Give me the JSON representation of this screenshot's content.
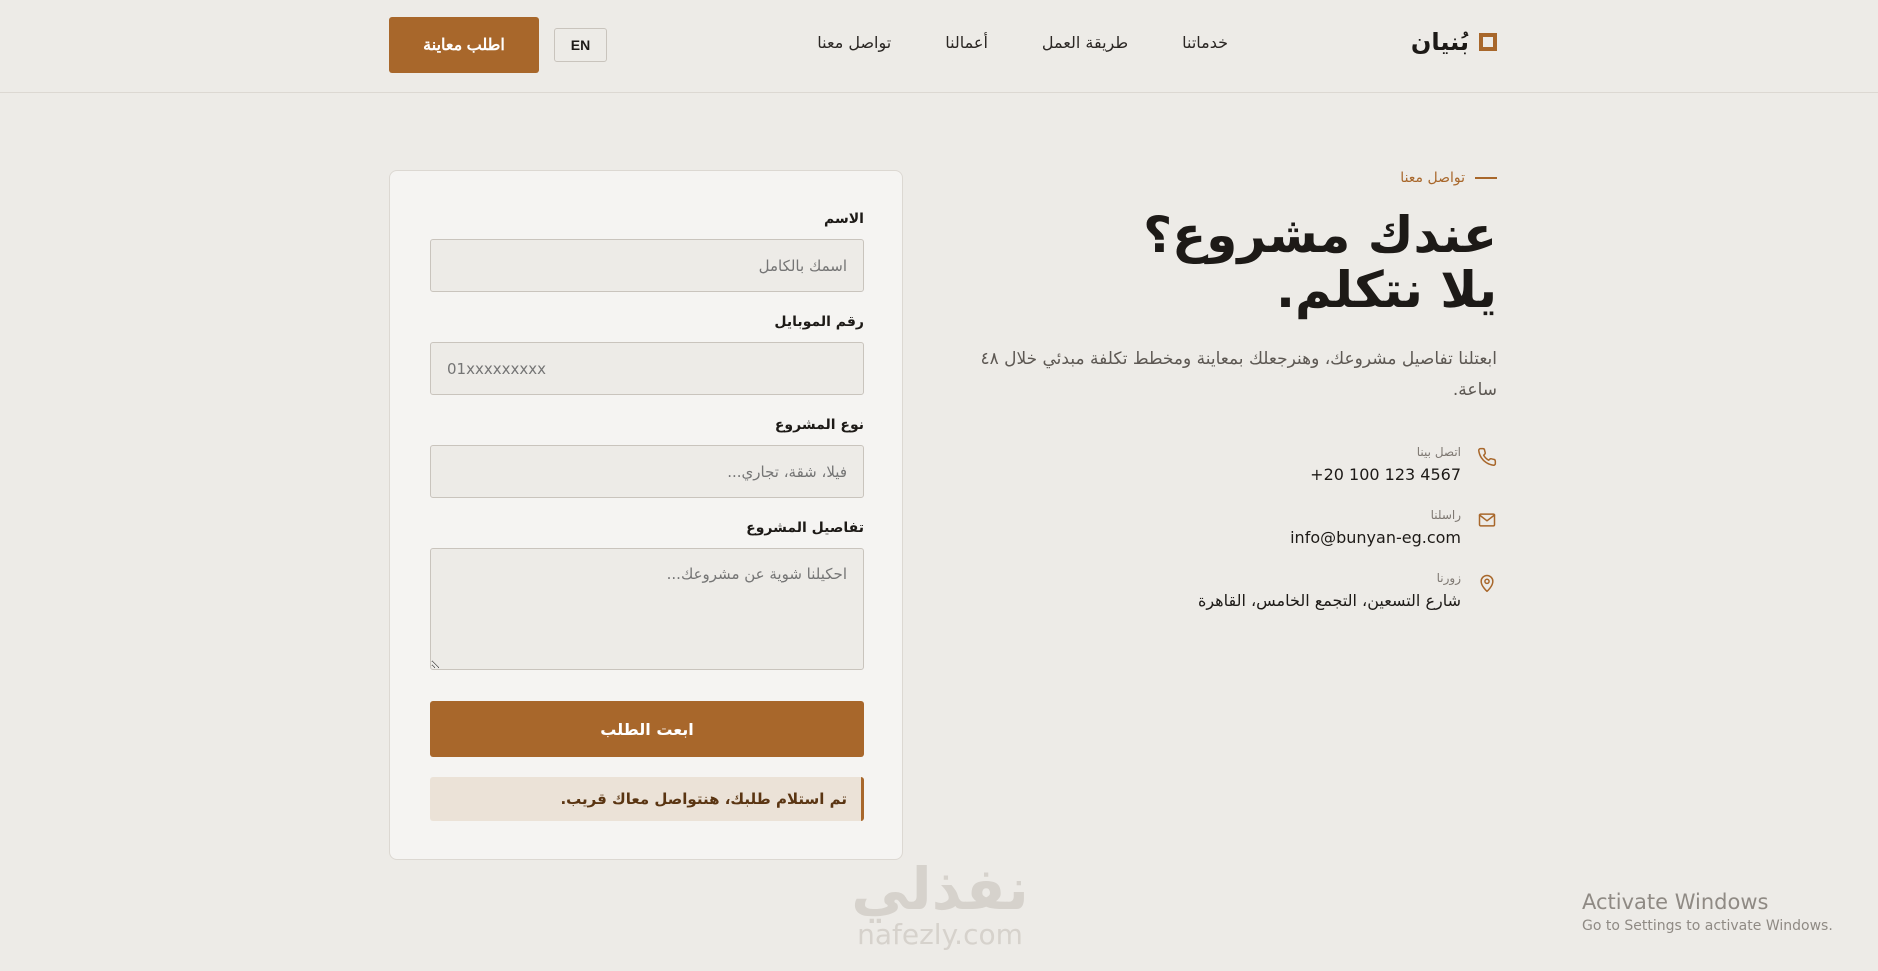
{
  "header": {
    "brand": "بُنيان",
    "nav": [
      "خدماتنا",
      "طريقة العمل",
      "أعمالنا",
      "تواصل معنا"
    ],
    "lang_label": "EN",
    "cta_label": "اطلب معاينة"
  },
  "info": {
    "eyebrow": "تواصل معنا",
    "headline_line1": "عندك مشروع؟",
    "headline_line2": "يلا نتكلم.",
    "lead": "ابعتلنا تفاصيل مشروعك، وهنرجعلك بمعاينة ومخطط تكلفة مبدئي خلال ٤٨ ساعة.",
    "contacts": [
      {
        "key": "اتصل بينا",
        "value": "+20 100 123 4567",
        "icon": "phone-icon"
      },
      {
        "key": "راسلنا",
        "value": "info@bunyan-eg.com",
        "icon": "mail-icon"
      },
      {
        "key": "زورنا",
        "value": "شارع التسعين، التجمع الخامس، القاهرة",
        "icon": "location-pin-icon"
      }
    ]
  },
  "form": {
    "name_label": "الاسم",
    "name_placeholder": "اسمك بالكامل",
    "phone_label": "رقم الموبايل",
    "phone_placeholder": "01xxxxxxxxx",
    "type_label": "نوع المشروع",
    "type_placeholder": "فيلا، شقة، تجاري...",
    "details_label": "تفاصيل المشروع",
    "details_placeholder": "احكيلنا شوية عن مشروعك...",
    "submit_label": "ابعت الطلب",
    "success_message": "تم استلام طلبك، هنتواصل معاك قريب."
  },
  "watermark": {
    "line1": "نفذلي",
    "line2": "nafezly.com"
  },
  "os_notice": {
    "line1": "Activate Windows",
    "line2": "Go to Settings to activate Windows."
  },
  "colors": {
    "accent": "#a8672b",
    "background": "#edebe7",
    "card": "#f5f4f2",
    "text": "#1d1a17"
  }
}
